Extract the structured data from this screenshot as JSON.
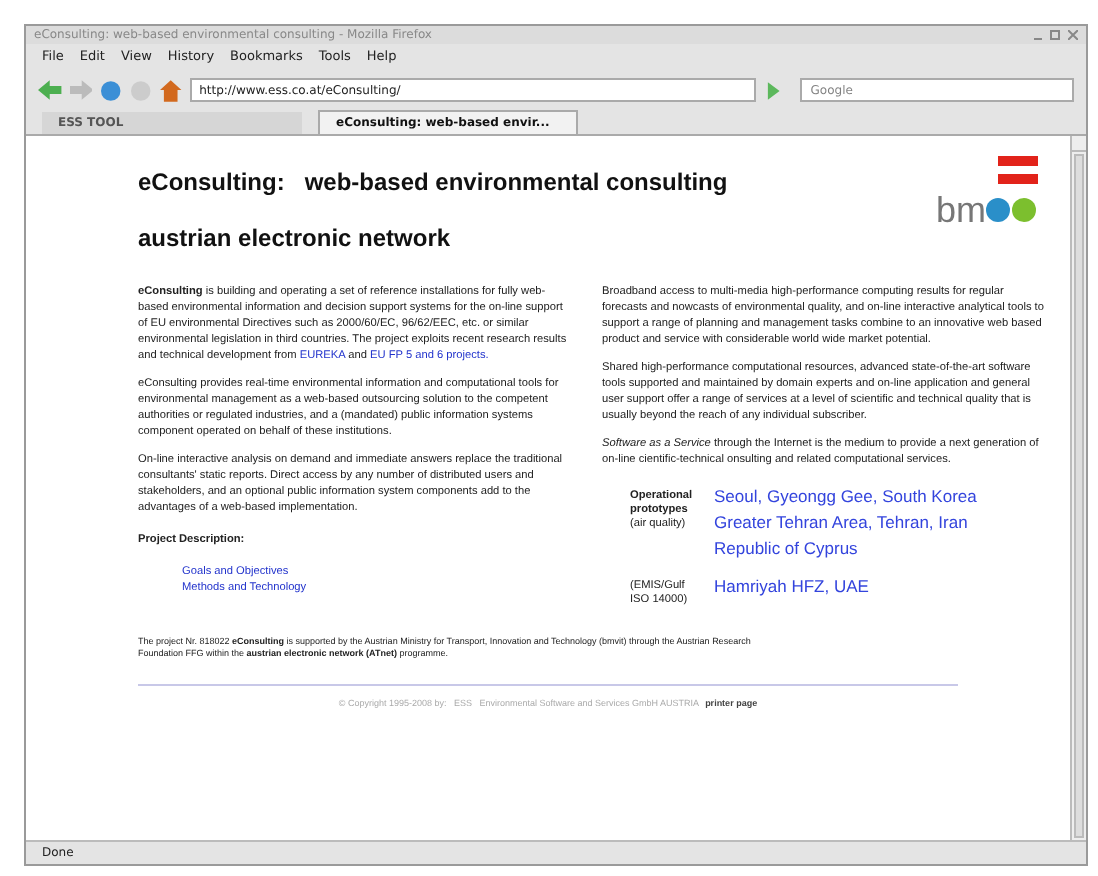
{
  "window": {
    "title": "eConsulting: web-based environmental consulting - Mozilla Firefox"
  },
  "menu": [
    "File",
    "Edit",
    "View",
    "History",
    "Bookmarks",
    "Tools",
    "Help"
  ],
  "toolbar": {
    "url": "http://www.ess.co.at/eConsulting/",
    "search_placeholder": "Google"
  },
  "tabs": [
    {
      "label": "ESS TOOL",
      "selected": false
    },
    {
      "label": "eConsulting: web-based envir...",
      "selected": true
    }
  ],
  "page": {
    "heading": "eConsulting:   web-based environmental consulting",
    "subheading": "austrian electronic network",
    "logo_text": "bm",
    "left_paragraphs": [
      [
        {
          "kind": "text",
          "text": "**eConsulting** is building and operating a set of reference installations for fully web-based environmental information and decision support systems for the on-line support of EU environmental Directives such as 2000/60/EC, 96/62/EEC, etc. or similar environmental legislation in third countries. The project exploits recent research results and technical development from"
        },
        {
          "kind": "link",
          "text": "EUREKA"
        },
        {
          "kind": "text",
          "text": "and"
        },
        {
          "kind": "link",
          "text": "EU FP 5 and 6 projects."
        }
      ],
      [
        {
          "kind": "text",
          "text": "eConsulting provides real-time environmental information and computational tools for environmental management as a web-based outsourcing solution to the competent authorities or regulated industries, and a (mandated) public information systems component operated on behalf of these institutions."
        }
      ],
      [
        {
          "kind": "text",
          "text": "On-line interactive analysis on demand and immediate answers replace the traditional consultants' static reports. Direct access by any number of distributed users and stakeholders, and an optional public information system components add to the advantages of a web-based implementation."
        }
      ]
    ],
    "project_title": "Project Description:",
    "project_links": [
      "Goals and Objectives",
      "Methods and Technology"
    ],
    "right_paragraphs": [
      "Broadband access to multi-media high-performance computing results for regular forecasts and nowcasts of environmental quality, and on-line interactive analytical tools to support a range of planning and management tasks combine to an innovative web based product and service with considerable world wide market potential.",
      "Shared high-performance computational resources, advanced state-of-the-art software tools supported and maintained by domain experts and on-line application and general user support offer a range of services at a level of scientific and technical quality that is usually beyond the reach of any individual subscriber.",
      "*Software as a Service* through the Internet is the medium to provide a next generation of on-line cientific-technical onsulting and related computational services."
    ],
    "prototypes": [
      {
        "label": "**Operational prototypes**\n(air quality)",
        "links": [
          "Seoul, Gyeongg Gee, South Korea",
          "Greater Tehran Area, Tehran, Iran",
          "Republic of Cyprus"
        ]
      },
      {
        "label": "(EMIS/Gulf\nISO 14000)",
        "links": [
          "Hamriyah HFZ, UAE"
        ]
      }
    ],
    "note": "The project Nr. 818022  **eConsulting**  is supported by the Austrian Ministry for Transport, Innovation and Technology (bmvit) through the Austrian Research Foundation FFG within the **austrian electronic network (ATnet)** programme.",
    "copyright": "© Copyright 1995-2008 by:   ESS   Environmental Software and Services GmbH AUSTRIA",
    "printer_link": "printer page"
  },
  "status_bar": "Done"
}
